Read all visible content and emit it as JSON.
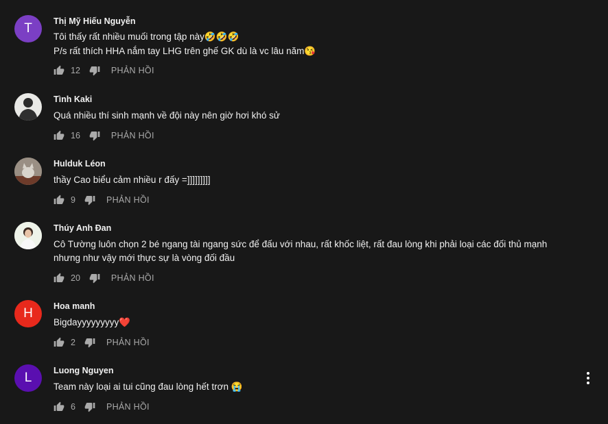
{
  "reply_label": "PHẢN HỒI",
  "colors": {
    "background": "#181818",
    "text": "#f1f1f1",
    "secondary": "#aaaaaa"
  },
  "comments": [
    {
      "avatar_letter": "T",
      "avatar_color": "#7b3fc4",
      "author": "Thị Mỹ Hiếu Nguyễn",
      "lines": [
        "Tôi thấy rất nhiều muối trong tập này🤣🤣🤣",
        "P/s rất thích HHA nắm tay LHG trên ghế GK dù là vc lâu năm😘"
      ],
      "likes": "12"
    },
    {
      "avatar_letter": "",
      "avatar_color": "#e9e9e6",
      "author": "Tình Kaki",
      "lines": [
        "Quá nhiều thí sinh mạnh về đội này nên giờ hơi khó sử"
      ],
      "likes": "16"
    },
    {
      "avatar_letter": "",
      "avatar_color": "#8d8377",
      "author": "Hulduk Léon",
      "lines": [
        "thầy Cao biểu cảm nhiều r đấy =]]]]]]]]]"
      ],
      "likes": "9"
    },
    {
      "avatar_letter": "",
      "avatar_color": "#f3f1ee",
      "author": "Thúy Anh Đan",
      "lines": [
        "Cô Tường luôn chọn 2 bé ngang tài ngang sức để đấu với nhau, rất khốc liệt, rất đau lòng khi phải loại các đối thủ mạnh",
        "nhưng như vậy mới thực sự là vòng đối đầu"
      ],
      "likes": "20"
    },
    {
      "avatar_letter": "H",
      "avatar_color": "#e8291c",
      "author": "Hoa manh",
      "lines": [
        "Bigdayyyyyyyyy❤️"
      ],
      "likes": "2"
    },
    {
      "avatar_letter": "L",
      "avatar_color": "#5a0fb0",
      "author": "Luong Nguyen",
      "lines": [
        "Team này loại ai tui cũng đau lòng hết trơn 😭"
      ],
      "likes": "6"
    }
  ]
}
